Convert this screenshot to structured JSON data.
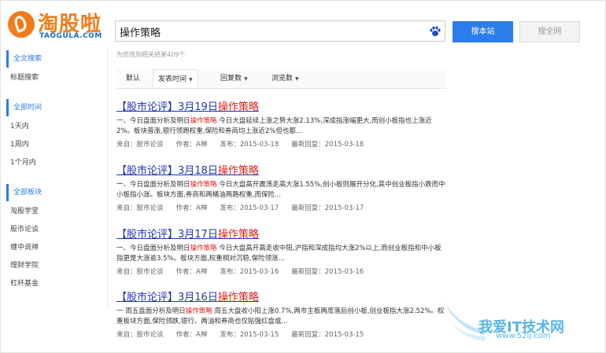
{
  "logo": {
    "name": "淘股啦",
    "url": "TAOGULA.COM"
  },
  "search": {
    "query": "操作策略",
    "site_button": "搜本站",
    "web_button": "搜全网"
  },
  "result_count": "为您找到相关结果409个",
  "tabs": [
    {
      "label": "默认"
    },
    {
      "label": "发表时间",
      "arrow": "▼"
    },
    {
      "label": "回复数",
      "arrow": "▼"
    },
    {
      "label": "浏览数",
      "arrow": "▼"
    }
  ],
  "sidebar": {
    "search_scope": {
      "title": "全文搜索",
      "items": [
        "标题搜索"
      ]
    },
    "time": {
      "title": "全部时间",
      "items": [
        "1天内",
        "1周内",
        "1个月内"
      ]
    },
    "boards": {
      "title": "全部板块",
      "items": [
        "淘股学堂",
        "股市论谈",
        "缠中说禅",
        "理财学院",
        "杠杆基金"
      ]
    }
  },
  "results": [
    {
      "title_prefix": "【股市论评】3月19日",
      "title_highlight": "操作策略",
      "snippet_a": "一、今日盘面分析及明日",
      "snippet_hl": "操作策略",
      "snippet_b": "今日大盘延续上涨之势大涨2.13%,深成指涨幅更大,而创小板指也上涨近2%。板块普涨,银行领跑权重,保险和券商均上涨近2%但也都...",
      "source": "来自：股市论谈",
      "author": "作者：A神",
      "published": "发布：2015-03-18",
      "last_reply": "最新回复：2015-03-18"
    },
    {
      "title_prefix": "【股市论评】3月18日",
      "title_highlight": "操作策略",
      "snippet_a": "一、今日盘面分析及明日",
      "snippet_hl": "操作策略",
      "snippet_b": "今日大盘高开震荡走高大涨1.55%,创小板则展开分化,其中创业板指小跌而中小板指小涨。板块方面,券商和两桶油两路权重,而保险...",
      "source": "来自：股市论谈",
      "author": "作者：A神",
      "published": "发布：2015-03-17",
      "last_reply": "最新回复：2015-03-17"
    },
    {
      "title_prefix": "【股市论评】3月17日",
      "title_highlight": "操作策略",
      "snippet_a": "一、今日盘面分析及明日",
      "snippet_hl": "操作策略",
      "snippet_b": "今日大盘高开高走收中阳,沪指和深成指均大涨2%以上,而创业板指和中小板指更是大涨逾3.5%。板块方面,权重相对沉稳,保险领涨...",
      "source": "来自：股市论谈",
      "author": "作者：A神",
      "published": "发布：2015-03-16",
      "last_reply": "最新回复：2015-03-16"
    },
    {
      "title_prefix": "【股市论评】3月16日",
      "title_highlight": "操作策略",
      "snippet_a": "一 周五盘面分析及明日",
      "snippet_hl": "操作策略",
      "snippet_b": "周五大盘收小阳上涨0.7%,两市主板两度落后创小板,创业板指大涨2.52%。权重板块方面,保险领跌,银行、两油和券商也仅贴强红盘或...",
      "source": "来自：股市论谈",
      "author": "作者：A神",
      "published": "发布：2015-03-15",
      "last_reply": "最新回复：2015-03-15"
    }
  ],
  "watermark": {
    "text": "我爱IT技术网",
    "url": "www.52ij.com"
  }
}
